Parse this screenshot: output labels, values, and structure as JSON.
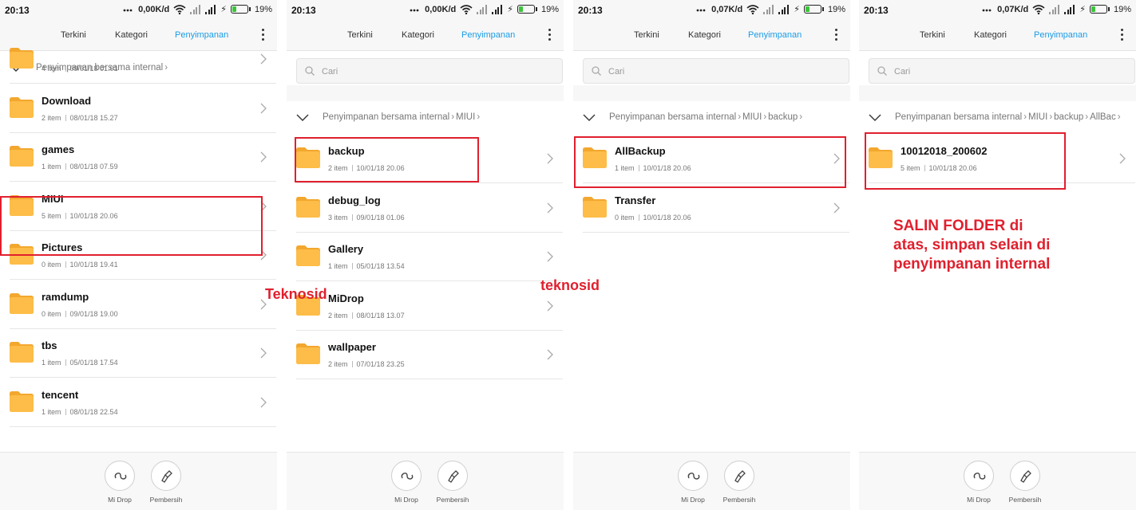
{
  "tabs": {
    "recent": "Terkini",
    "category": "Kategori",
    "storage": "Penyimpanan"
  },
  "search_placeholder": "Cari",
  "bottom": {
    "midrop": "Mi Drop",
    "cleaner": "Pembersih"
  },
  "colors": {
    "accent": "#1a9ce6",
    "highlight": "#e0202e",
    "folder": "#fdbd48"
  },
  "panels": [
    {
      "status": {
        "time": "20:13",
        "speed": "0,00K/d",
        "battery": "19%"
      },
      "breadcrumb": [
        "Penyimpanan bersama internal"
      ],
      "items": [
        {
          "name": "",
          "count": "4 item",
          "date": "09/01/18 01.01"
        },
        {
          "name": "Download",
          "count": "2 item",
          "date": "08/01/18 15.27"
        },
        {
          "name": "games",
          "count": "1 item",
          "date": "08/01/18 07.59"
        },
        {
          "name": "MIUI",
          "count": "5 item",
          "date": "10/01/18 20.06"
        },
        {
          "name": "Pictures",
          "count": "0 item",
          "date": "10/01/18 19.41"
        },
        {
          "name": "ramdump",
          "count": "0 item",
          "date": "09/01/18 19.00"
        },
        {
          "name": "tbs",
          "count": "1 item",
          "date": "05/01/18 17.54"
        },
        {
          "name": "tencent",
          "count": "1 item",
          "date": "08/01/18 22.54"
        }
      ]
    },
    {
      "status": {
        "time": "20:13",
        "speed": "0,00K/d",
        "battery": "19%"
      },
      "breadcrumb": [
        "Penyimpanan bersama internal",
        "MIUI"
      ],
      "items": [
        {
          "name": "backup",
          "count": "2 item",
          "date": "10/01/18 20.06"
        },
        {
          "name": "debug_log",
          "count": "3 item",
          "date": "09/01/18 01.06"
        },
        {
          "name": "Gallery",
          "count": "1 item",
          "date": "05/01/18 13.54"
        },
        {
          "name": "MiDrop",
          "count": "2 item",
          "date": "08/01/18 13.07"
        },
        {
          "name": "wallpaper",
          "count": "2 item",
          "date": "07/01/18 23.25"
        }
      ]
    },
    {
      "status": {
        "time": "20:13",
        "speed": "0,07K/d",
        "battery": "19%"
      },
      "breadcrumb": [
        "Penyimpanan bersama internal",
        "MIUI",
        "backup"
      ],
      "items": [
        {
          "name": "AllBackup",
          "count": "1 item",
          "date": "10/01/18 20.06"
        },
        {
          "name": "Transfer",
          "count": "0 item",
          "date": "10/01/18 20.06"
        }
      ]
    },
    {
      "status": {
        "time": "20:13",
        "speed": "0,07K/d",
        "battery": "19%"
      },
      "breadcrumb": [
        "Penyimpanan bersama internal",
        "MIUI",
        "backup",
        "AllBac"
      ],
      "items": [
        {
          "name": "10012018_200602",
          "count": "5 item",
          "date": "10/01/18 20.06"
        }
      ]
    }
  ],
  "annotations": {
    "watermark_1": "Teknosid",
    "watermark_2": "teknosid",
    "note": "SALIN FOLDER di atas, simpan selain di penyimpanan internal"
  }
}
